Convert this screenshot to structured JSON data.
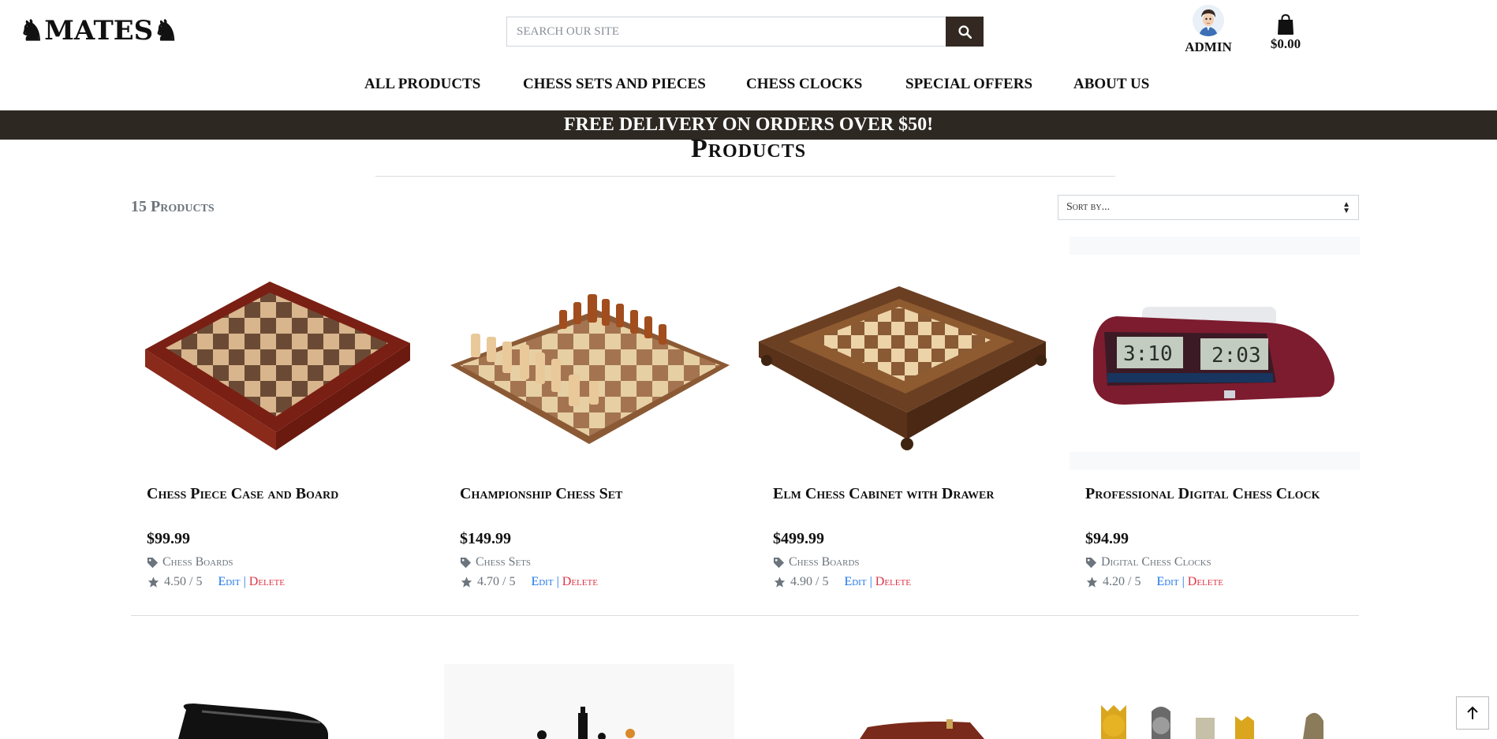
{
  "brand": {
    "logo_text": "MATES"
  },
  "search": {
    "placeholder": "SEARCH OUR SITE"
  },
  "account": {
    "admin_label": "ADMIN",
    "cart_total": "$0.00"
  },
  "nav": {
    "items": [
      "ALL PRODUCTS",
      "CHESS SETS AND PIECES",
      "CHESS CLOCKS",
      "SPECIAL OFFERS",
      "ABOUT US"
    ]
  },
  "banner": {
    "text": "FREE DELIVERY ON ORDERS OVER $50!"
  },
  "page": {
    "title": "Products",
    "count": "15 Products",
    "sort_placeholder": "Sort by..."
  },
  "products": [
    {
      "name": "Chess Piece Case and Board",
      "price": "$99.99",
      "category": "Chess Boards",
      "rating": "4.50 / 5",
      "edit": "Edit",
      "delete": "Delete"
    },
    {
      "name": "Championship Chess Set",
      "price": "$149.99",
      "category": "Chess Sets",
      "rating": "4.70 / 5",
      "edit": "Edit",
      "delete": "Delete"
    },
    {
      "name": "Elm Chess Cabinet with Drawer",
      "price": "$499.99",
      "category": "Chess Boards",
      "rating": "4.90 / 5",
      "edit": "Edit",
      "delete": "Delete"
    },
    {
      "name": "Professional Digital Chess Clock",
      "price": "$94.99",
      "category": "Digital Chess Clocks",
      "rating": "4.20 / 5",
      "edit": "Edit",
      "delete": "Delete"
    }
  ],
  "clock_display": {
    "left": "3:10",
    "right": "2:03"
  },
  "colors": {
    "banner": "#2e2822",
    "edit": "#1a73e8",
    "delete": "#dc3545",
    "muted": "#6c757d"
  },
  "icons": [
    "knight-icon",
    "search-icon",
    "shopping-bag-icon",
    "tag-icon",
    "star-icon",
    "arrow-up-icon"
  ]
}
